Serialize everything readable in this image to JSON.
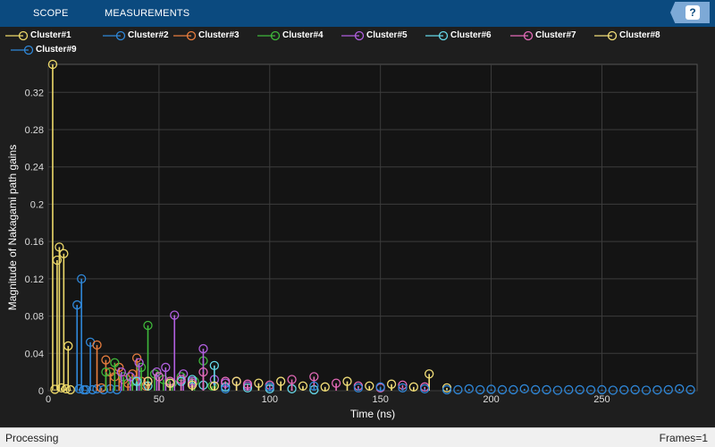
{
  "toolstrip": {
    "tabs": [
      "SCOPE",
      "MEASUREMENTS"
    ],
    "help_label": "?"
  },
  "colors": {
    "toolstrip": "#0b4a7f",
    "background": "#1e1e1e",
    "axes_background": "#141414",
    "grid": "#3c3c3c",
    "text": "#ffffff"
  },
  "chart_data": {
    "type": "stem",
    "xlabel": "Time (ns)",
    "ylabel": "Magnitude of Nakagami path gains",
    "xlim": [
      0,
      293
    ],
    "ylim": [
      0,
      0.35
    ],
    "xticks": [
      0,
      50,
      100,
      150,
      200,
      250
    ],
    "yticks": [
      0,
      0.04,
      0.08,
      0.12,
      0.16,
      0.2,
      0.24,
      0.28,
      0.32
    ],
    "grid": true,
    "legend_position": "top",
    "series": [
      {
        "name": "Cluster#1",
        "color": "#edd96a",
        "x": [
          2,
          3,
          4,
          5,
          6,
          7,
          8,
          9,
          10
        ],
        "y": [
          0.35,
          0.0015,
          0.14,
          0.154,
          0.003,
          0.147,
          0.002,
          0.048,
          0.001
        ]
      },
      {
        "name": "Cluster#2",
        "color": "#2f87d8",
        "x": [
          13,
          14,
          15,
          16,
          17,
          19,
          20,
          22,
          25,
          28,
          31
        ],
        "y": [
          0.092,
          0.002,
          0.12,
          0.001,
          0.001,
          0.052,
          0.001,
          0.002,
          0.001,
          0.002,
          0.001
        ]
      },
      {
        "name": "Cluster#3",
        "color": "#e87d3e",
        "x": [
          22,
          24,
          26,
          28,
          30,
          32,
          34,
          36,
          38,
          40,
          42,
          44
        ],
        "y": [
          0.049,
          0.003,
          0.033,
          0.02,
          0.015,
          0.025,
          0.012,
          0.008,
          0.018,
          0.035,
          0.01,
          0.005
        ]
      },
      {
        "name": "Cluster#4",
        "color": "#3fb83b",
        "x": [
          26,
          30,
          34,
          38,
          42,
          45,
          48,
          52,
          56,
          60,
          66,
          70,
          74
        ],
        "y": [
          0.02,
          0.03,
          0.015,
          0.01,
          0.025,
          0.07,
          0.018,
          0.012,
          0.008,
          0.015,
          0.01,
          0.032,
          0.005
        ]
      },
      {
        "name": "Cluster#5",
        "color": "#b05fde",
        "x": [
          33,
          37,
          41,
          45,
          49,
          53,
          57,
          61,
          65,
          70,
          75,
          80,
          85,
          90
        ],
        "y": [
          0.02,
          0.015,
          0.03,
          0.01,
          0.02,
          0.025,
          0.081,
          0.018,
          0.01,
          0.045,
          0.012,
          0.008,
          0.01,
          0.005
        ]
      },
      {
        "name": "Cluster#6",
        "color": "#66d8e8",
        "x": [
          40,
          45,
          50,
          55,
          60,
          65,
          70,
          75,
          80,
          90,
          100,
          110,
          120
        ],
        "y": [
          0.01,
          0.005,
          0.015,
          0.008,
          0.01,
          0.012,
          0.006,
          0.027,
          0.004,
          0.003,
          0.002,
          0.002,
          0.001
        ]
      },
      {
        "name": "Cluster#7",
        "color": "#e46ab8",
        "x": [
          50,
          55,
          60,
          65,
          70,
          80,
          90,
          100,
          110,
          120,
          130,
          140,
          150,
          160,
          170
        ],
        "y": [
          0.015,
          0.01,
          0.012,
          0.008,
          0.02,
          0.01,
          0.007,
          0.006,
          0.012,
          0.015,
          0.008,
          0.005,
          0.003,
          0.006,
          0.004
        ]
      },
      {
        "name": "Cluster#8",
        "color": "#f2de78",
        "x": [
          45,
          55,
          65,
          75,
          85,
          95,
          105,
          115,
          125,
          135,
          145,
          155,
          165,
          172,
          180
        ],
        "y": [
          0.01,
          0.008,
          0.006,
          0.005,
          0.01,
          0.008,
          0.01,
          0.005,
          0.004,
          0.01,
          0.005,
          0.007,
          0.004,
          0.018,
          0.003
        ]
      },
      {
        "name": "Cluster#9",
        "color": "#2f87d8",
        "x": [
          80,
          100,
          120,
          140,
          150,
          160,
          170,
          180,
          185,
          190,
          195,
          200,
          205,
          210,
          215,
          220,
          225,
          230,
          235,
          240,
          245,
          250,
          255,
          260,
          265,
          270,
          275,
          280,
          285,
          290
        ],
        "y": [
          0.002,
          0.004,
          0.005,
          0.003,
          0.004,
          0.003,
          0.002,
          0.001,
          0.001,
          0.002,
          0.001,
          0.0015,
          0.001,
          0.001,
          0.002,
          0.001,
          0.001,
          0.0005,
          0.001,
          0.001,
          0.0008,
          0.001,
          0.0005,
          0.0008,
          0.001,
          0.0005,
          0.0008,
          0.001,
          0.002,
          0.001
        ]
      }
    ]
  },
  "status": {
    "left": "Processing",
    "right": "Frames=1"
  }
}
